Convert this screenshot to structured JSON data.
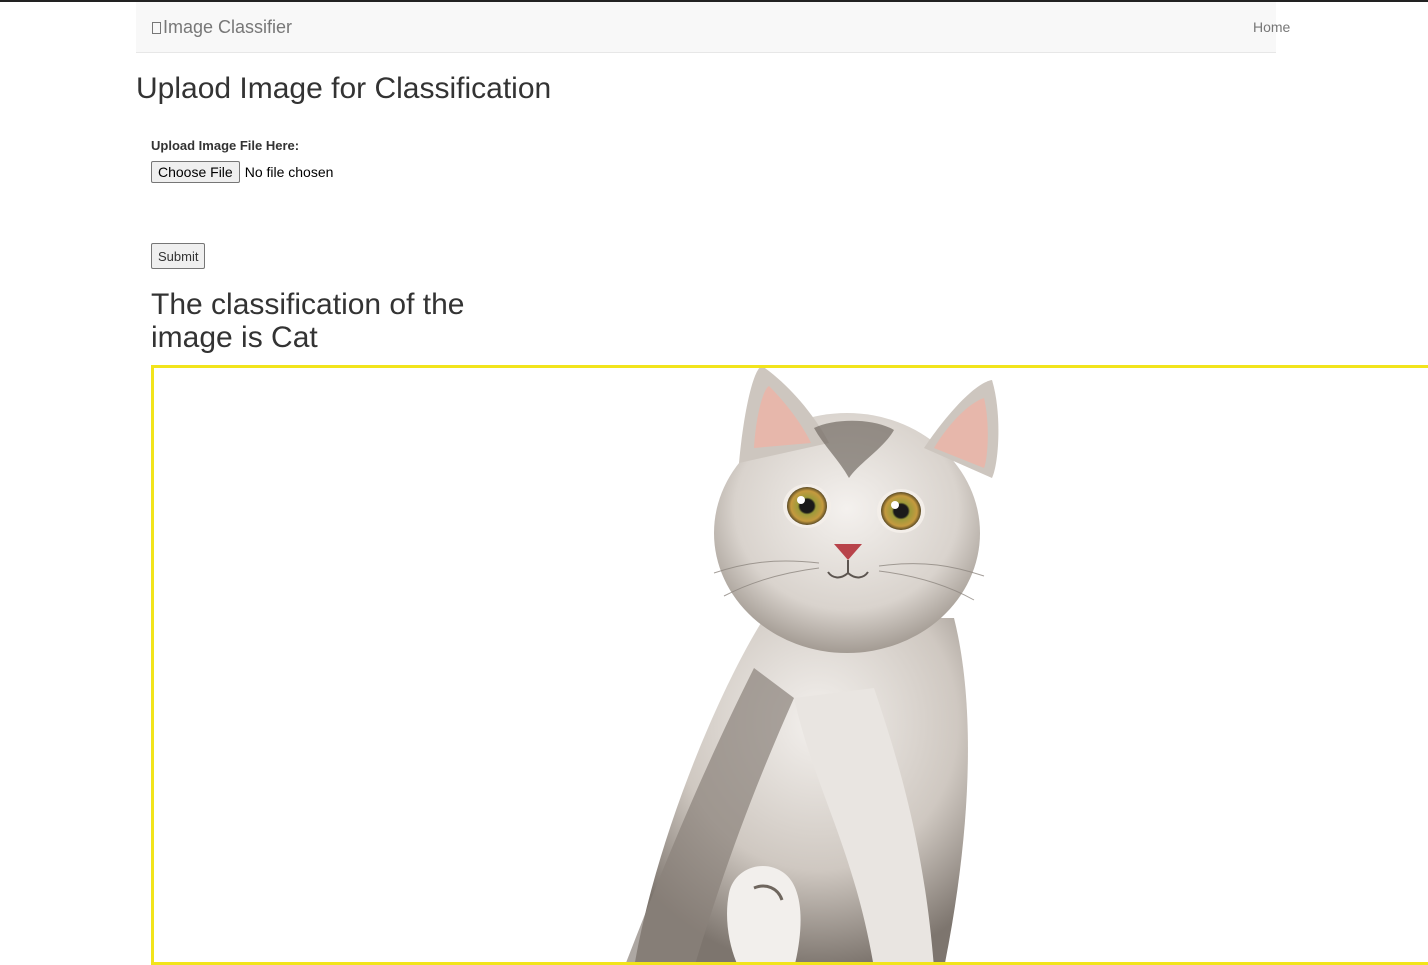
{
  "navbar": {
    "brand_label": "Image Classifier",
    "brand_icon": "glyph-placeholder-icon",
    "links": [
      {
        "label": "Home"
      }
    ]
  },
  "page": {
    "title": "Uplaod Image for Classification"
  },
  "upload_form": {
    "label": "Upload Image File Here:",
    "choose_button_label": "Choose File",
    "file_status": "No file chosen",
    "submit_label": "Submit"
  },
  "result": {
    "text": "The classification of the image is Cat",
    "image_subject": "cat"
  },
  "colors": {
    "navbar_bg": "#f8f8f8",
    "frame_border": "#f2e41b",
    "text": "#333333"
  }
}
